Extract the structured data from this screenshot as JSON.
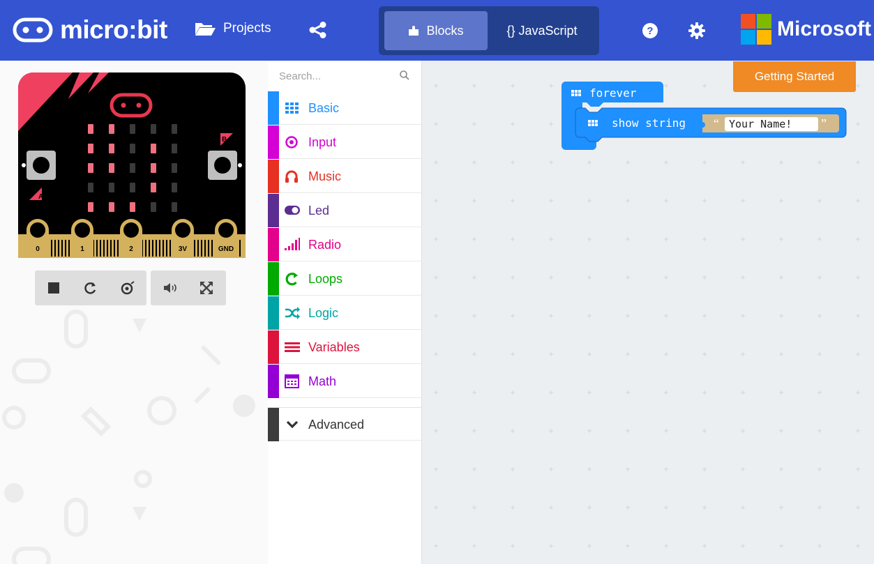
{
  "header": {
    "brand": "micro:bit",
    "projects_label": "Projects",
    "tabs": [
      {
        "label": "Blocks",
        "active": true
      },
      {
        "label": "{} JavaScript",
        "active": false
      }
    ],
    "microsoft_label": "Microsoft"
  },
  "simulator": {
    "pins": [
      "0",
      "1",
      "2",
      "3V",
      "GND"
    ],
    "button_a": "A",
    "button_b": "B",
    "led_matrix": [
      [
        1,
        1,
        0,
        0,
        0
      ],
      [
        1,
        1,
        0,
        1,
        0
      ],
      [
        1,
        1,
        0,
        1,
        0
      ],
      [
        0,
        0,
        0,
        1,
        0
      ],
      [
        1,
        1,
        1,
        0,
        0
      ]
    ],
    "controls": [
      "stop-icon",
      "restart-icon",
      "slow-mo-icon",
      "mute-icon",
      "fullscreen-icon"
    ]
  },
  "toolbox": {
    "search_placeholder": "Search...",
    "categories": [
      {
        "label": "Basic",
        "color": "#1e90ff",
        "icon": "grid-icon"
      },
      {
        "label": "Input",
        "color": "#d400d4",
        "icon": "target-icon"
      },
      {
        "label": "Music",
        "color": "#e63022",
        "icon": "headphones-icon"
      },
      {
        "label": "Led",
        "color": "#5c2d91",
        "icon": "toggle-icon"
      },
      {
        "label": "Radio",
        "color": "#e3008c",
        "icon": "signal-icon"
      },
      {
        "label": "Loops",
        "color": "#00aa00",
        "icon": "loop-icon"
      },
      {
        "label": "Logic",
        "color": "#00a4a6",
        "icon": "shuffle-icon"
      },
      {
        "label": "Variables",
        "color": "#dc143c",
        "icon": "lines-icon"
      },
      {
        "label": "Math",
        "color": "#9400d3",
        "icon": "calculator-icon"
      }
    ],
    "advanced_label": "Advanced"
  },
  "workspace": {
    "getting_started_label": "Getting Started",
    "blocks": {
      "event_label": "forever",
      "statement_label": "show string",
      "string_value": "Your Name!",
      "open_quote": "“",
      "close_quote": "”"
    }
  }
}
